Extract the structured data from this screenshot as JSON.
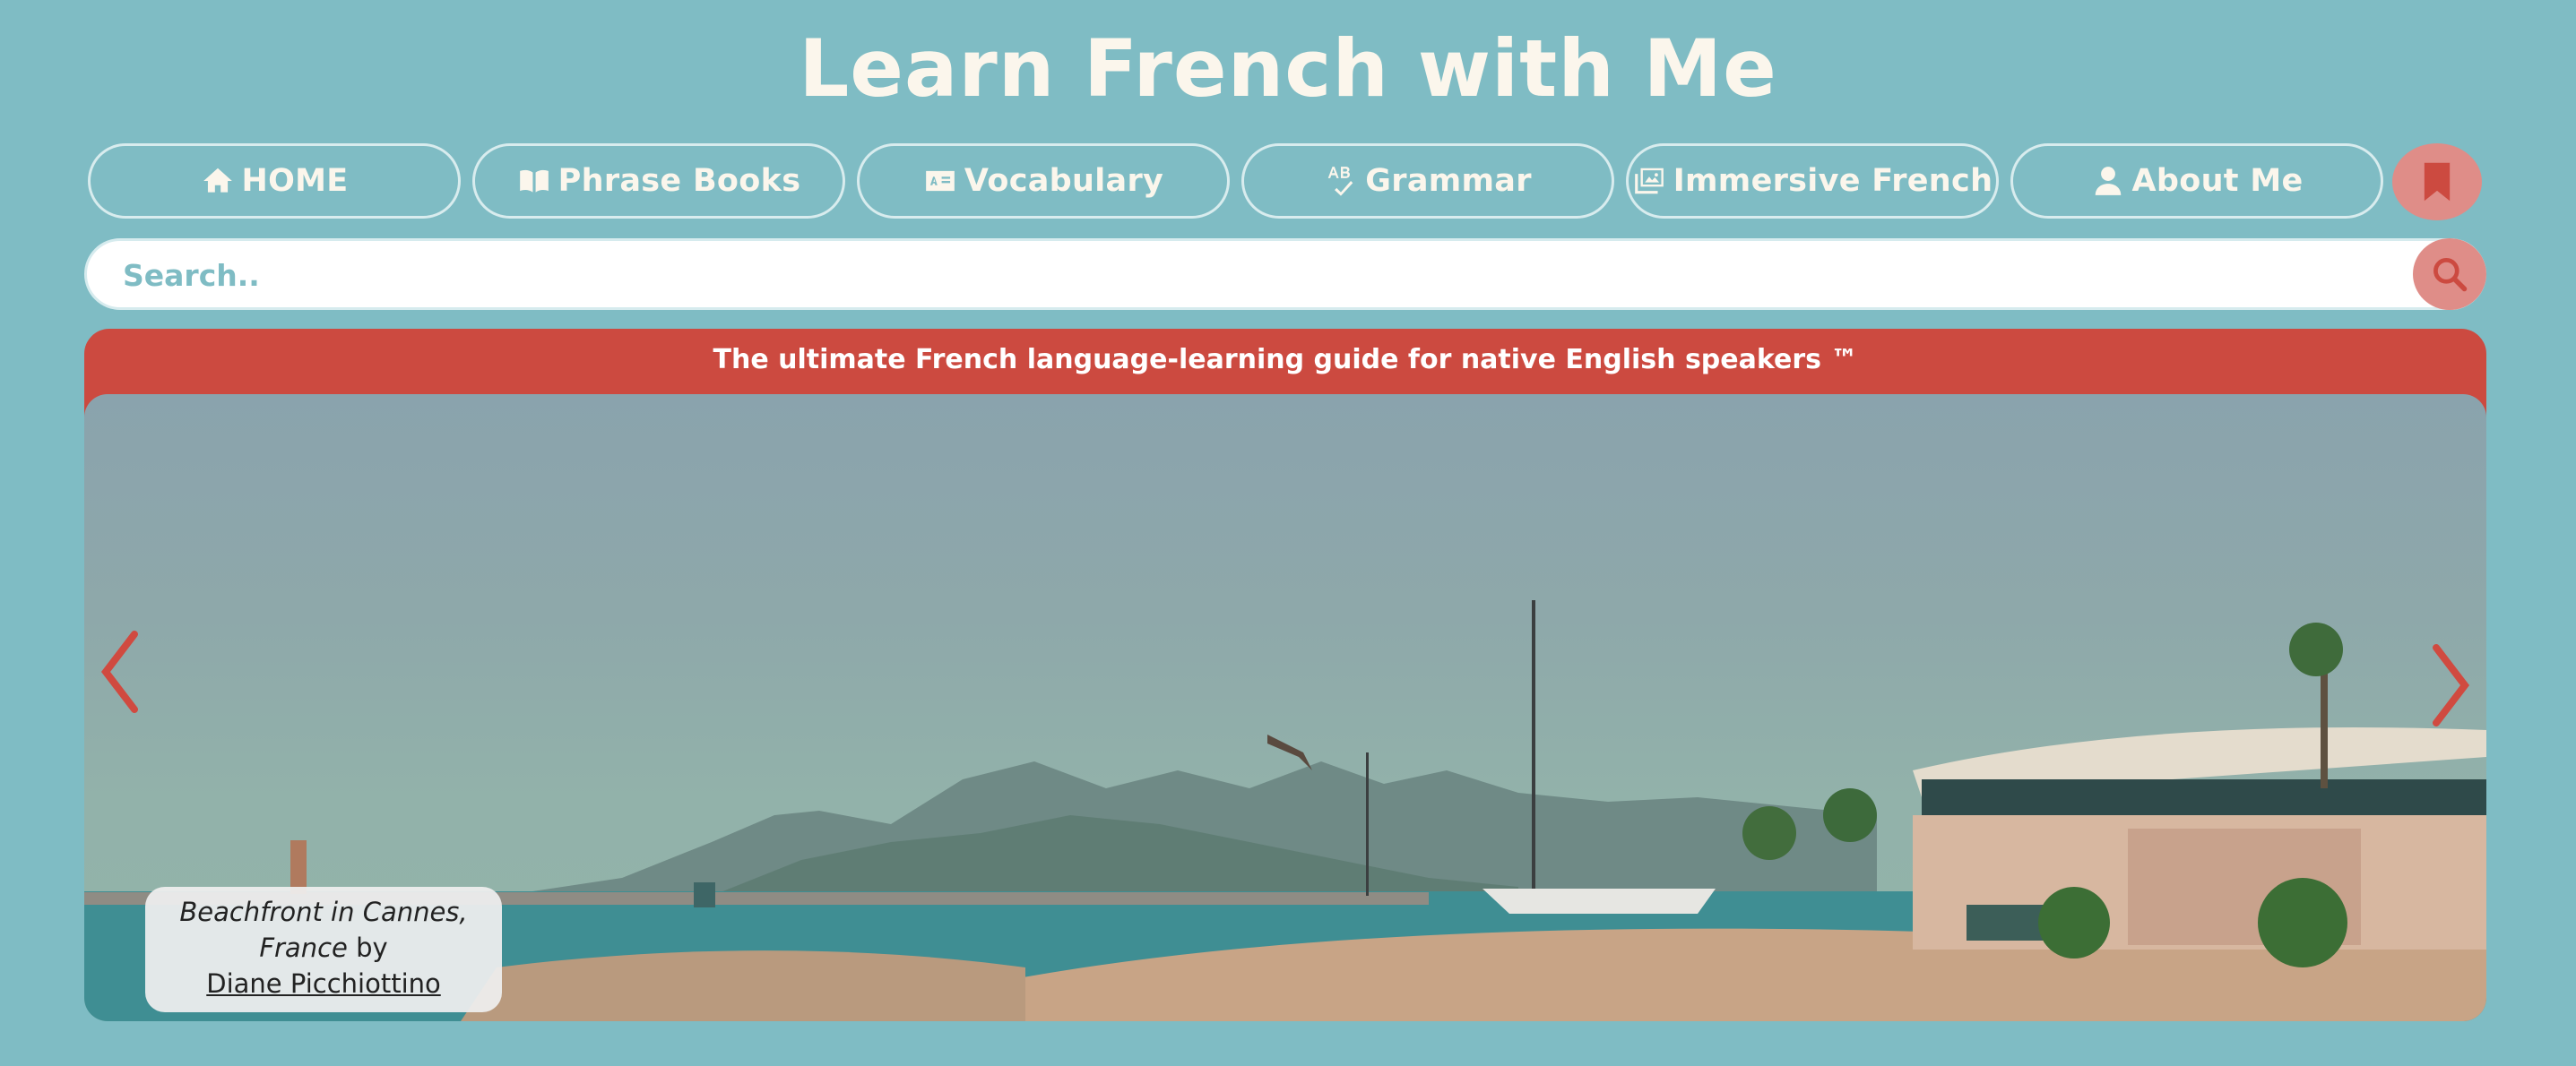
{
  "site": {
    "title": "Learn French with Me"
  },
  "nav": {
    "items": [
      {
        "label": "HOME",
        "icon": "home-icon"
      },
      {
        "label": "Phrase Books",
        "icon": "book-open-icon"
      },
      {
        "label": "Vocabulary",
        "icon": "vocabulary-card-icon"
      },
      {
        "label": "Grammar",
        "icon": "spell-check-icon"
      },
      {
        "label": "Immersive French",
        "icon": "photo-gallery-icon"
      },
      {
        "label": "About Me",
        "icon": "user-icon"
      }
    ],
    "bookmark_icon": "bookmark-icon"
  },
  "search": {
    "placeholder": "Search..",
    "icon": "search-icon"
  },
  "banner": {
    "text": "The ultimate French language-learning guide for native English speakers ™"
  },
  "hero": {
    "caption": {
      "title_line1": "Beachfront in Cannes,",
      "title_line2": "France",
      "by": " by",
      "author": "Diane Picchiottino"
    },
    "prev_icon": "chevron-left-icon",
    "next_icon": "chevron-right-icon"
  },
  "colors": {
    "background": "#7fbcc4",
    "accent_red": "#cc4a40",
    "button_pink": "#df8d88",
    "text_light": "#fbf6ec"
  }
}
